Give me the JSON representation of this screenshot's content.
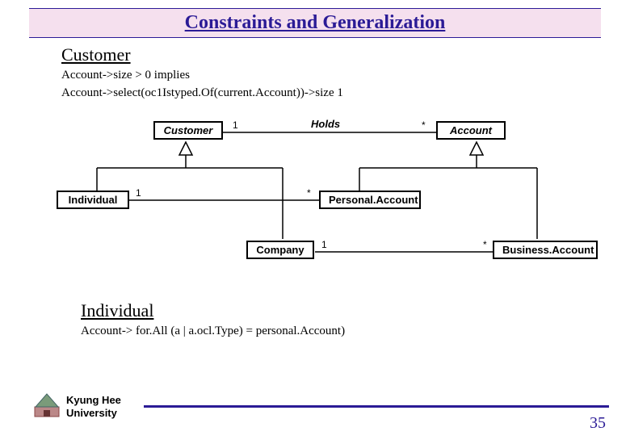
{
  "title": "Constraints and Generalization",
  "section1": {
    "heading": "Customer",
    "line1": "Account->size > 0 implies",
    "line2": "Account->select(oc1Istyped.Of(current.Account))->size 1"
  },
  "diagram": {
    "assoc_label": "Holds",
    "mult_cust": "1",
    "mult_acct": "*",
    "mult_ind": "1",
    "mult_pa": "*",
    "mult_comp": "1",
    "mult_ba": "*",
    "boxes": {
      "customer": "Customer",
      "account": "Account",
      "individual": "Individual",
      "personal_account": "Personal.Account",
      "company": "Company",
      "business_account": "Business.Account"
    }
  },
  "section2": {
    "heading": "Individual",
    "line1": "Account-> for.All (a | a.ocl.Type) = personal.Account)"
  },
  "footer": {
    "university": "Kyung Hee\nUniversity",
    "page": "35"
  }
}
